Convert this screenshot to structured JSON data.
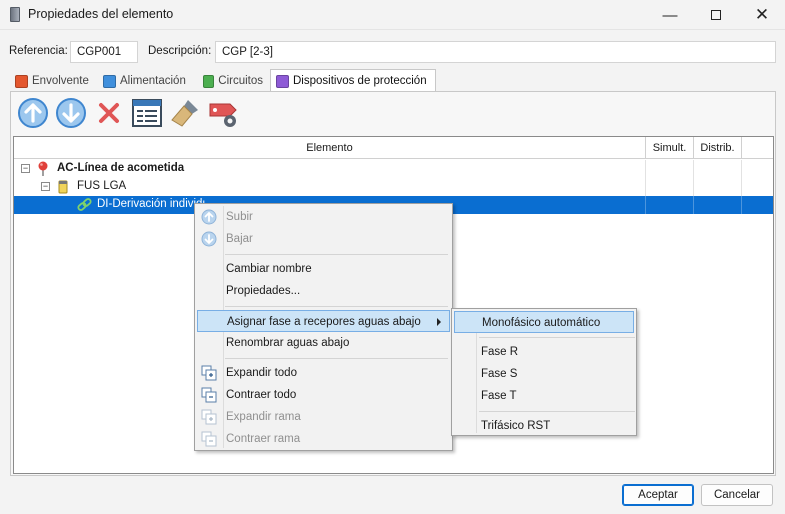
{
  "window": {
    "title": "Propiedades del elemento",
    "min_glyph": "—",
    "close_glyph": "✕"
  },
  "header": {
    "ref_label": "Referencia:",
    "ref_value": "CGP001",
    "desc_label": "Descripción:",
    "desc_value": "CGP [2-3]"
  },
  "tabs": [
    {
      "label": "Envolvente",
      "icon": "envelope-icon",
      "color": "#e4572e"
    },
    {
      "label": "Alimentación",
      "icon": "feed-icon",
      "color": "#3f8fdc"
    },
    {
      "label": "Circuitos",
      "icon": "circuits-icon",
      "color": "#4caf50"
    },
    {
      "label": "Dispositivos de protección",
      "icon": "protection-devices-icon",
      "color": "#8e5bd6"
    }
  ],
  "toolbar": [
    "move-up-icon",
    "move-down-icon",
    "delete-icon",
    "properties-window-icon",
    "brush-icon",
    "label-settings-icon"
  ],
  "grid": {
    "columns": [
      "Elemento",
      "Simult.",
      "Distrib."
    ],
    "rows": [
      {
        "label": "AC-Línea de acometida",
        "expander": "−",
        "icon": "pin-icon"
      },
      {
        "label": "FUS LGA",
        "expander": "−",
        "icon": "fuse-icon"
      },
      {
        "label": "DI-Derivación individual",
        "icon": "link-icon"
      }
    ]
  },
  "context_menu": {
    "items": [
      {
        "label": "Subir",
        "disabled": true
      },
      {
        "label": "Bajar",
        "disabled": true
      },
      {
        "label": "Cambiar nombre"
      },
      {
        "label": "Propiedades..."
      },
      {
        "label": "Asignar fase a recepores aguas abajo"
      },
      {
        "label": "Renombrar aguas abajo"
      },
      {
        "label": "Expandir todo"
      },
      {
        "label": "Contraer todo"
      },
      {
        "label": "Expandir rama",
        "disabled": true
      },
      {
        "label": "Contraer rama",
        "disabled": true
      }
    ]
  },
  "submenu": {
    "items": [
      {
        "label": "Monofásico automático"
      },
      {
        "label": "Fase R"
      },
      {
        "label": "Fase S"
      },
      {
        "label": "Fase T"
      },
      {
        "label": "Trifásico RST"
      }
    ]
  },
  "buttons": {
    "accept": "Aceptar",
    "cancel": "Cancelar"
  },
  "colors": {
    "selection": "#0a6ed1",
    "menu_highlight": "#cce4f7"
  }
}
